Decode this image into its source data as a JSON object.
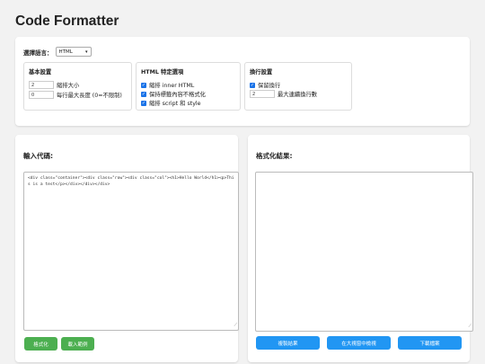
{
  "page": {
    "title": "Code Formatter"
  },
  "settings": {
    "language_label": "選擇語言：",
    "language_selected": "HTML",
    "basic": {
      "title": "基本設置",
      "indent_size_value": "2",
      "indent_size_label": "縮排大小",
      "max_line_value": "0",
      "max_line_label": "每行最大長度 (0=不限制)"
    },
    "html_options": {
      "title": "HTML 特定選項",
      "indent_inner_html": "縮排 inner HTML",
      "preserve_heading": "保持標籤內容不格式化",
      "indent_script_style": "縮排 script 和 style"
    },
    "wrap": {
      "title": "換行設置",
      "preserve_newlines": "保留換行",
      "max_newlines_value": "2",
      "max_newlines_label": "最大連續換行數"
    }
  },
  "input": {
    "title": "輸入代碼:",
    "code": "<div class=\"container\"><div class=\"row\"><div class=\"col\"><h1>Hello World</h1><p>This is a test</p></div></div></div>",
    "format_button": "格式化",
    "load_example_button": "載入範例"
  },
  "output": {
    "title": "格式化結果:",
    "code": "",
    "copy_button": "複製結果",
    "open_window_button": "在大視窗中檢視",
    "download_button": "下載檔案"
  },
  "colors": {
    "green": "#4caf50",
    "blue": "#2196f3",
    "checkbox": "#1a73e8"
  }
}
